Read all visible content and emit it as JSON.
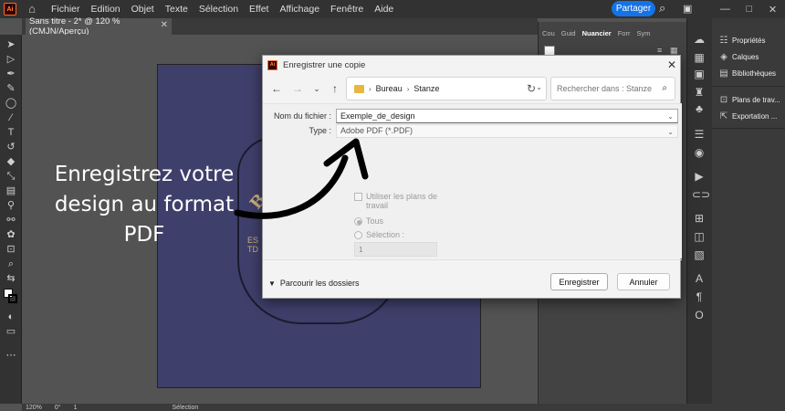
{
  "app": {
    "menus": [
      "Fichier",
      "Edition",
      "Objet",
      "Texte",
      "Sélection",
      "Effet",
      "Affichage",
      "Fenêtre",
      "Aide"
    ],
    "share_label": "Partager",
    "doc_tab_title": "Sans titre - 2* @ 120 % (CMJN/Aperçu)"
  },
  "panel": {
    "tabs": [
      "Cou",
      "Guid",
      "Nuancier",
      "Forr",
      "Sym"
    ],
    "right_items": [
      {
        "label": "Propriétés",
        "icon": "properties-icon"
      },
      {
        "label": "Calques",
        "icon": "layers-icon"
      },
      {
        "label": "Bibliothèques",
        "icon": "libraries-icon"
      },
      {
        "label": "Plans de trav...",
        "icon": "artboards-icon"
      },
      {
        "label": "Exportation ...",
        "icon": "export-icon"
      }
    ]
  },
  "overlay": {
    "line1": "Enregistrez votre",
    "line2": "design au format",
    "line3": "PDF"
  },
  "artwork": {
    "badge_word": "BAR",
    "badge_sub1": "ES",
    "badge_sub2": "TD"
  },
  "dialog": {
    "title": "Enregistrer une copie",
    "path": [
      "Bureau",
      "Stanze"
    ],
    "search_placeholder": "Rechercher dans : Stanze",
    "filename_label": "Nom du fichier :",
    "filename_value": "Exemple_de_design",
    "type_label": "Type :",
    "type_value": "Adobe PDF (*.PDF)",
    "use_artboards_label_1": "Utiliser les plans de",
    "use_artboards_label_2": "travail",
    "all_label": "Tous",
    "selection_label": "Sélection :",
    "range_value": "1",
    "browse_label": "Parcourir les dossiers",
    "save_label": "Enregistrer",
    "cancel_label": "Annuler"
  },
  "status": {
    "zoom": "120%",
    "angle": "0°",
    "page": "1",
    "mode": "Sélection"
  }
}
